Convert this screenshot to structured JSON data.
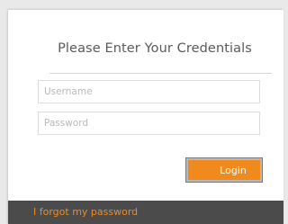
{
  "login": {
    "title": "Please Enter Your Credentials",
    "username_placeholder": "Username",
    "password_placeholder": "Password",
    "login_label": "Login",
    "forgot_label": "I forgot my password"
  },
  "colors": {
    "accent": "#f08a1c",
    "footer_bg": "#4b4b4b",
    "background": "#e9e9e9"
  }
}
